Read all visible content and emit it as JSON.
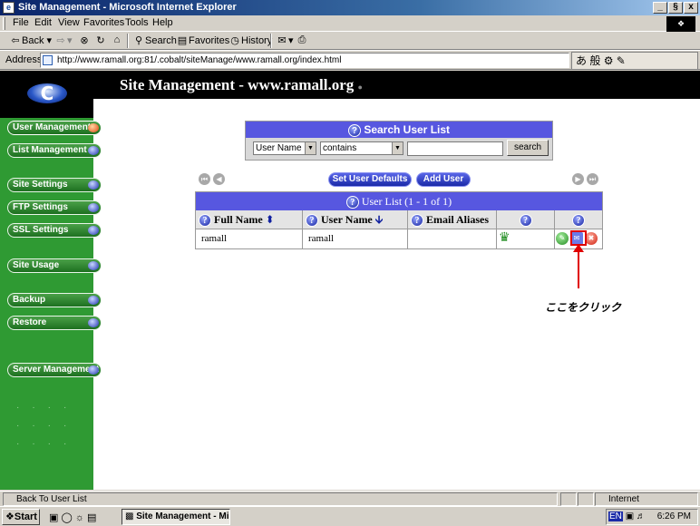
{
  "window": {
    "title": "Site Management - Microsoft Internet Explorer",
    "minimize": "_",
    "maximize": "§",
    "close": "x"
  },
  "menu": [
    "File",
    "Edit",
    "View",
    "Favorites",
    "Tools",
    "Help"
  ],
  "toolbar": {
    "back": "Back",
    "search": "Search",
    "favorites": "Favorites",
    "history": "History"
  },
  "address": {
    "label": "Address",
    "url": "http://www.ramall.org:81/.cobalt/siteManage/www.ramall.org/index.html"
  },
  "ime": "あ 般",
  "page": {
    "title": "Site Management - www.ramall.org",
    "logo_letter": "C",
    "sidebar": [
      {
        "label": "User Management",
        "active": true
      },
      {
        "label": "List Management"
      },
      {
        "label": "Site Settings"
      },
      {
        "label": "FTP Settings"
      },
      {
        "label": "SSL Settings"
      },
      {
        "label": "Site Usage"
      },
      {
        "label": "Backup"
      },
      {
        "label": "Restore"
      },
      {
        "label": "Server Management"
      }
    ],
    "search": {
      "title": "Search User List",
      "field": "User Name",
      "operator": "contains",
      "value": "",
      "button": "search"
    },
    "buttons": {
      "set_defaults": "Set User Defaults",
      "add_user": "Add User"
    },
    "user_list": {
      "title": "User List (1 - 1 of 1)",
      "columns": [
        "Full Name",
        "User Name",
        "Email Aliases"
      ],
      "rows": [
        {
          "full_name": "ramall",
          "user_name": "ramall",
          "email_aliases": ""
        }
      ]
    },
    "annotation": "ここをクリック"
  },
  "status": {
    "text": "Back To User List",
    "zone": "Internet"
  },
  "taskbar": {
    "start": "Start",
    "task": "Site Management - Mi...",
    "lang": "EN",
    "clock": "6:26 PM"
  },
  "colors": {
    "header_blue": "#5757e0",
    "sidebar_green": "#2f9a33",
    "annotation_red": "#e00000"
  }
}
